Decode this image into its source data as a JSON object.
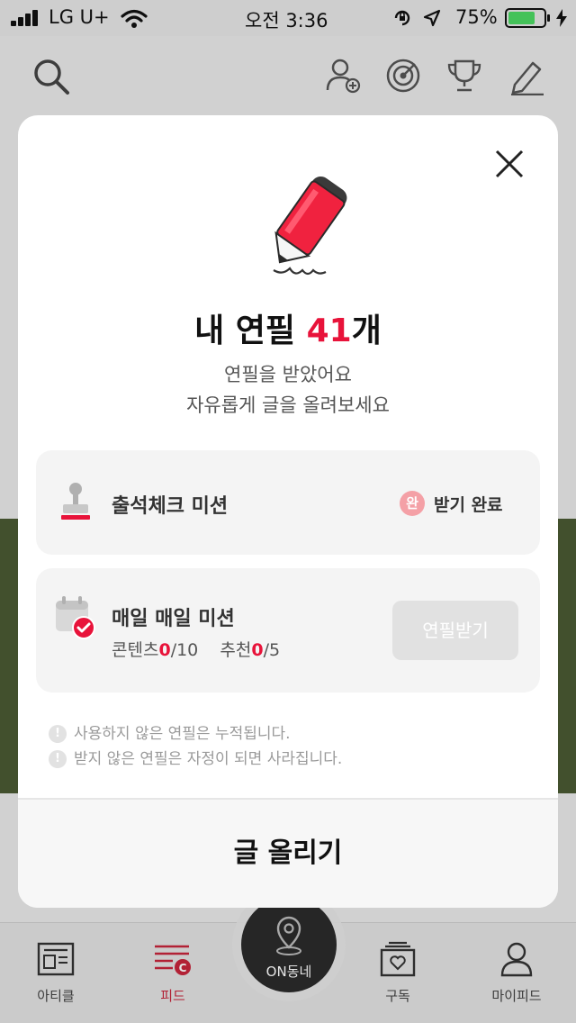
{
  "status_bar": {
    "carrier": "LG U+",
    "time": "오전 3:36",
    "battery_percent": "75%",
    "battery_level": 0.75
  },
  "top_bar_icons": [
    "search-icon",
    "add-user-icon",
    "target-icon",
    "trophy-icon",
    "pencil-icon"
  ],
  "modal": {
    "title_prefix": "내 연필 ",
    "title_count": "41",
    "title_suffix": "개",
    "subtitle_line1": "연필을 받았어요",
    "subtitle_line2": "자유롭게 글을 올려보세요",
    "attendance": {
      "title": "출석체크 미션",
      "badge": "완",
      "status": "받기 완료"
    },
    "daily": {
      "title": "매일 매일 미션",
      "content_label": "콘텐츠",
      "content_done": "0",
      "content_total": "/10",
      "recommend_label": "추천",
      "recommend_done": "0",
      "recommend_total": "/5",
      "receive_button": "연필받기"
    },
    "notices": [
      "사용하지 않은 연필은 누적됩니다.",
      "받지 않은 연필은 자정이 되면 사라집니다."
    ],
    "notice_icon": "!",
    "post_button": "글 올리기"
  },
  "tabbar": {
    "tabs": [
      {
        "label": "아티클"
      },
      {
        "label": "피드"
      },
      {
        "label": "ON동네"
      },
      {
        "label": "구독"
      },
      {
        "label": "마이피드"
      }
    ],
    "active_tab": "피드"
  },
  "colors": {
    "accent": "#e8133a",
    "pencil_red": "#f0223f",
    "badge_pink": "#f4a0a6",
    "disabled_button": "#e1e1e1",
    "background_band": "#4a5a33"
  }
}
